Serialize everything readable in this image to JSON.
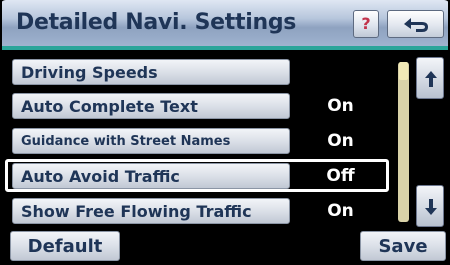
{
  "header": {
    "title": "Detailed Navi. Settings",
    "help_label": "?"
  },
  "rows": [
    {
      "label": "Driving Speeds",
      "value": ""
    },
    {
      "label": "Auto Complete Text",
      "value": "On"
    },
    {
      "label": "Guidance with Street Names",
      "value": "On"
    },
    {
      "label": "Auto Avoid Traffic",
      "value": "Off"
    },
    {
      "label": "Show Free Flowing Traffic",
      "value": "On"
    }
  ],
  "footer": {
    "default_label": "Default",
    "save_label": "Save"
  },
  "colors": {
    "header_text": "#1f3557",
    "accent_line": "#2aa59a",
    "help_mark": "#c2334b",
    "scrollbar": "#d9d2a8"
  },
  "icons": {
    "back": "back-arrow-icon",
    "scroll_up": "arrow-up-icon",
    "scroll_down": "arrow-down-icon"
  }
}
